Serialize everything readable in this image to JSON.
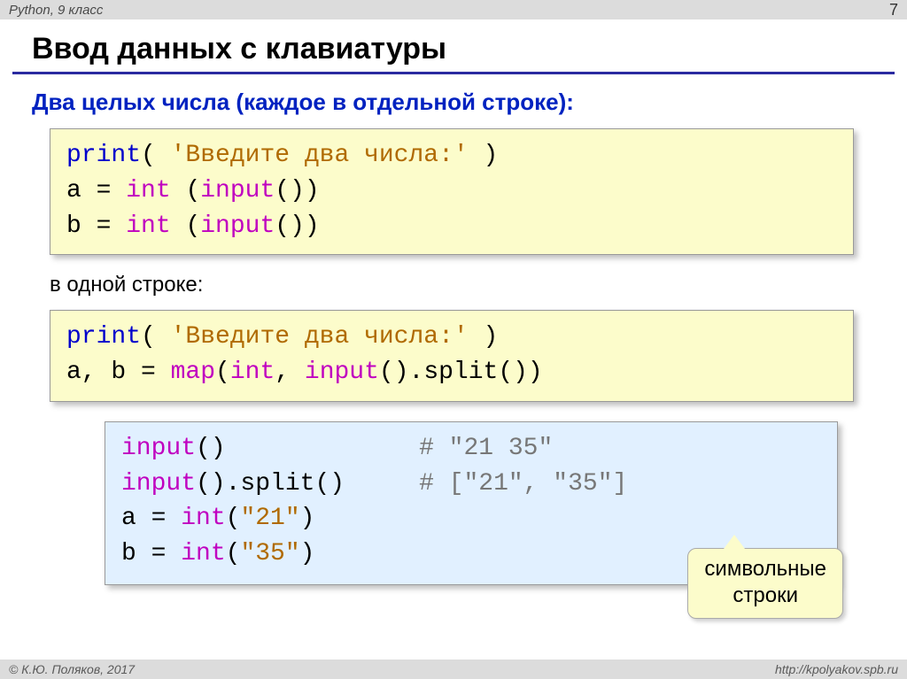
{
  "header": {
    "left": "Python, 9 класс",
    "page": "7"
  },
  "title": "Ввод данных с клавиатуры",
  "subtitle": "Два целых числа (каждое в отдельной строке):",
  "code1": {
    "l1_print": "print",
    "l1_str": "'Введите два числа:'",
    "l2a": "a = ",
    "l2int": "int",
    "l2b": " (",
    "l2input": "input",
    "l2c": "())",
    "l3a": "b = ",
    "l3int": "int",
    "l3b": " (",
    "l3input": "input",
    "l3c": "())"
  },
  "note": "в одной строке:",
  "code2": {
    "l1_print": "print",
    "l1_str": "'Введите два числа:'",
    "l2a": "a, b = ",
    "l2map": "map",
    "l2b": "(",
    "l2int": "int",
    "l2c": ", ",
    "l2input": "input",
    "l2d": "().split())"
  },
  "code3": {
    "l1input": "input",
    "l1rest": "()",
    "l1comm": "# \"21 35\"",
    "l2input": "input",
    "l2rest": "().split()",
    "l2comm": "# [\"21\", \"35\"]",
    "l3a": "a = ",
    "l3int": "int",
    "l3b": "(",
    "l3str": "\"21\"",
    "l3c": ")",
    "l4a": "b = ",
    "l4int": "int",
    "l4b": "(",
    "l4str": "\"35\"",
    "l4c": ")"
  },
  "callout": {
    "l1": "символьные",
    "l2": "строки"
  },
  "footer": {
    "left": "© К.Ю. Поляков, 2017",
    "right": "http://kpolyakov.spb.ru"
  }
}
